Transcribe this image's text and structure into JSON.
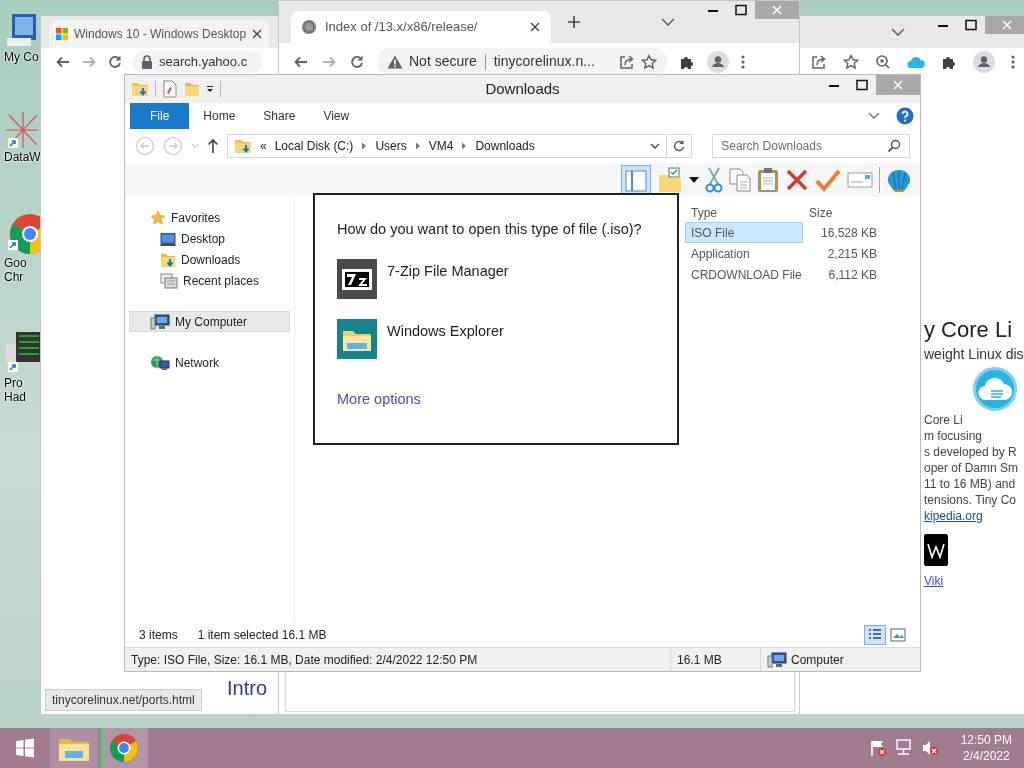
{
  "desktop_icons": [
    {
      "kind": "computer",
      "lines": [
        "My Co"
      ]
    },
    {
      "kind": "web",
      "lines": [
        "DataW"
      ]
    },
    {
      "kind": "chrome",
      "lines": [
        "Goo",
        "Chr"
      ]
    },
    {
      "kind": "app",
      "lines": [
        "Pro",
        "Had"
      ]
    }
  ],
  "back_browser": {
    "tab_title": "Windows 10 - Windows Desktop",
    "address": "search.yahoo.c",
    "page": {
      "heading": "y Core Li",
      "subheading": "weight Linux dis",
      "paragraph_lines": [
        "Core Li",
        "m focusing",
        "s developed by R",
        "oper of Damn Sm",
        "11 to 16 MB) and",
        "tensions. Tiny Co"
      ],
      "link": "kipedia.org",
      "logo_caption": "Viki",
      "intro": "Intro"
    },
    "status_url": "tinycorelinux.net/ports.html"
  },
  "front_browser": {
    "tab_title": "Index of /13.x/x86/release/",
    "security": "Not secure",
    "address": "tinycorelinux.n..."
  },
  "explorer": {
    "title": "Downloads",
    "ribbon_tabs": [
      {
        "label": "File",
        "kind": "file"
      },
      {
        "label": "Home",
        "kind": "tab"
      },
      {
        "label": "Share",
        "kind": "tab"
      },
      {
        "label": "View",
        "kind": "tab"
      }
    ],
    "breadcrumb_overflow": "«",
    "breadcrumb": [
      "Local Disk (C:)",
      "Users",
      "VM4",
      "Downloads"
    ],
    "search": {
      "placeholder": "Search Downloads"
    },
    "nav_pane": [
      {
        "label": "Favorites",
        "kind": "star",
        "selected": false,
        "children": [
          {
            "label": "Desktop",
            "kind": "desktop",
            "selected": false
          },
          {
            "label": "Downloads",
            "kind": "downloads",
            "selected": false
          },
          {
            "label": "Recent places",
            "kind": "recent",
            "selected": false
          }
        ]
      },
      {
        "label": "My Computer",
        "kind": "computer",
        "selected": true
      },
      {
        "label": "Network",
        "kind": "network",
        "selected": false
      }
    ],
    "columns": [
      "Type",
      "Size"
    ],
    "rows": [
      {
        "type": "ISO File",
        "size": "16,528 KB",
        "selected": true
      },
      {
        "type": "Application",
        "size": "2,215 KB",
        "selected": false
      },
      {
        "type": "CRDOWNLOAD File",
        "size": "6,112 KB",
        "selected": false
      }
    ],
    "item_count": "3 items",
    "selection_info": "1 item selected  16.1 MB",
    "status_bar": {
      "details": "Type: ISO File, Size: 16.1 MB, Date modified: 2/4/2022 12:50 PM",
      "size": "16.1 MB",
      "location": "Computer"
    }
  },
  "dialog": {
    "question": "How do you want to open this type of file (.iso)?",
    "options": [
      {
        "label": "7-Zip File Manager",
        "kind": "archiver"
      },
      {
        "label": "Windows Explorer",
        "kind": "explorer"
      }
    ],
    "more": "More options"
  },
  "taskbar": {
    "apps": [
      {
        "kind": "explorer",
        "active": false
      },
      {
        "kind": "chrome",
        "active": true
      }
    ],
    "time": "12:50 PM",
    "date": "2/4/2022"
  }
}
